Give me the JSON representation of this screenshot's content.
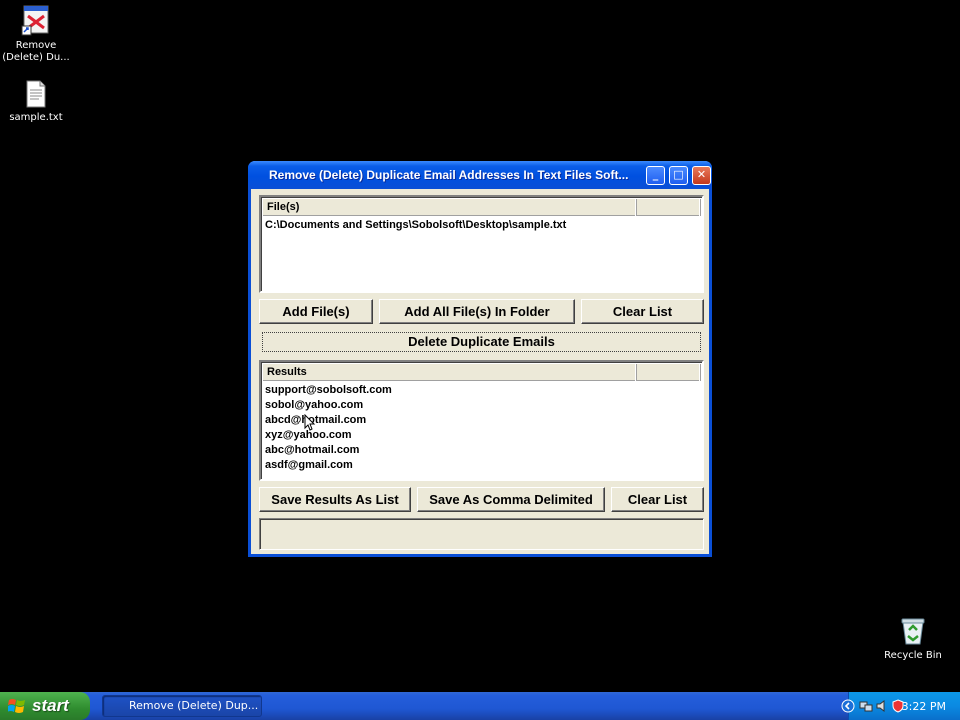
{
  "desktop": {
    "icons": [
      {
        "label": "Remove\n(Delete) Du...",
        "icon": "app-shortcut-icon"
      },
      {
        "label": "sample.txt",
        "icon": "text-file-icon"
      },
      {
        "label": "Recycle Bin",
        "icon": "recycle-bin-icon"
      }
    ]
  },
  "window": {
    "title": "Remove (Delete) Duplicate Email Addresses In Text Files Soft...",
    "files": {
      "header": "File(s)",
      "rows": [
        "C:\\Documents and Settings\\Sobolsoft\\Desktop\\sample.txt"
      ]
    },
    "file_buttons": {
      "add_files": "Add File(s)",
      "add_all_in_folder": "Add All File(s) In Folder",
      "clear_list": "Clear List"
    },
    "delete_button": "Delete Duplicate Emails",
    "results": {
      "header": "Results",
      "rows": [
        "support@sobolsoft.com",
        "sobol@yahoo.com",
        "abcd@hotmail.com",
        "xyz@yahoo.com",
        "abc@hotmail.com",
        "asdf@gmail.com"
      ]
    },
    "result_buttons": {
      "save_list": "Save Results As List",
      "save_comma": "Save As Comma Delimited",
      "clear_list": "Clear List"
    }
  },
  "taskbar": {
    "start_label": "start",
    "task_button": "Remove (Delete) Dup...",
    "clock": "3:22 PM"
  },
  "colors": {
    "titlebar": "#0a4fd6",
    "taskbar": "#245edb",
    "start": "#2f8c2f",
    "tray": "#0b8ae2"
  }
}
